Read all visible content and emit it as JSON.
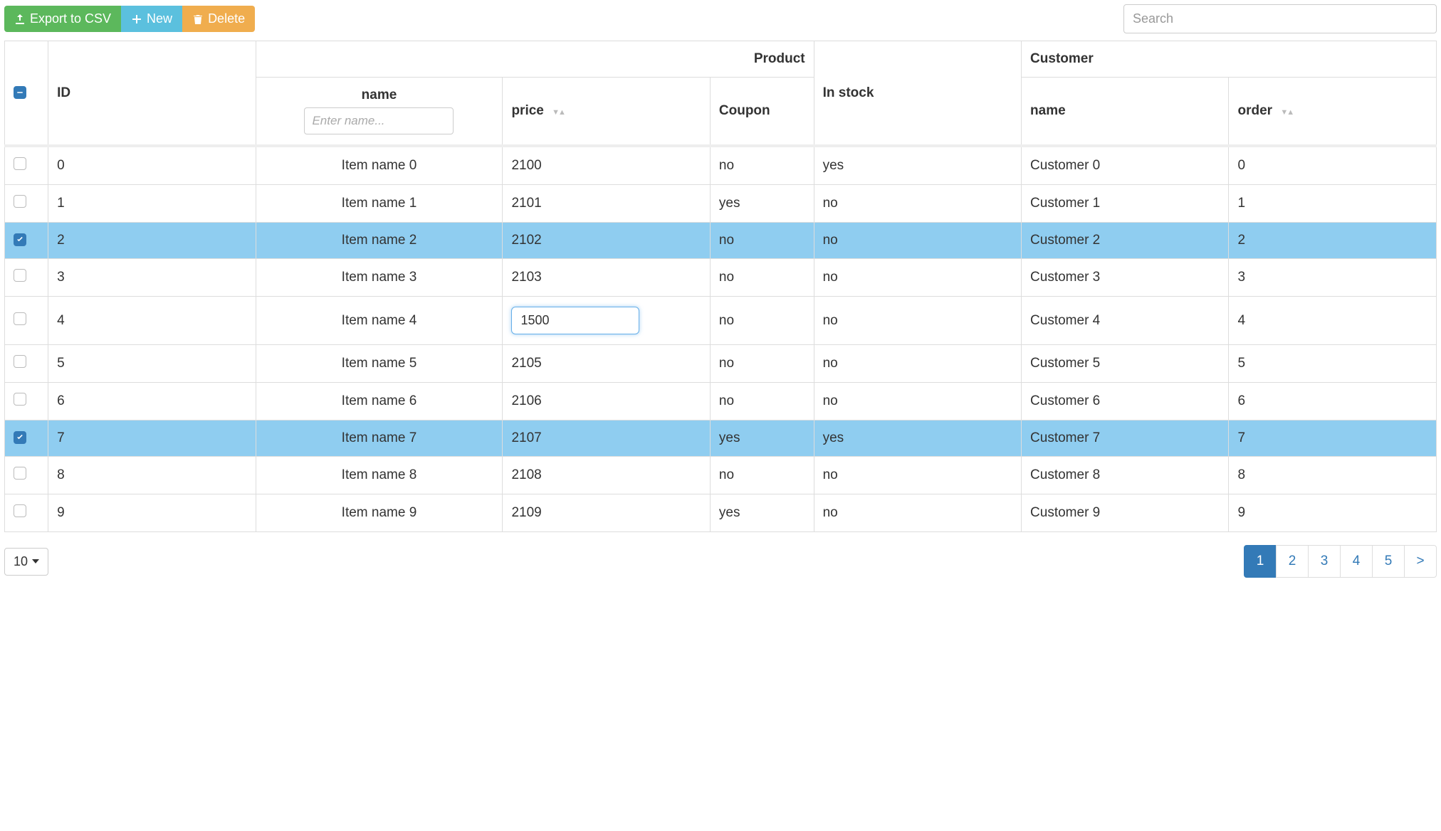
{
  "toolbar": {
    "export_label": "Export to CSV",
    "new_label": "New",
    "delete_label": "Delete",
    "search_placeholder": "Search"
  },
  "headers": {
    "id": "ID",
    "product_group": "Product",
    "name": "name",
    "name_placeholder": "Enter name...",
    "price": "price",
    "coupon": "Coupon",
    "in_stock": "In stock",
    "customer_group": "Customer",
    "customer_name": "name",
    "order": "order"
  },
  "rows": [
    {
      "checked": false,
      "id": "0",
      "name": "Item name 0",
      "price": "2100",
      "coupon": "no",
      "in_stock": "yes",
      "customer": "Customer 0",
      "order": "0",
      "editing": false
    },
    {
      "checked": false,
      "id": "1",
      "name": "Item name 1",
      "price": "2101",
      "coupon": "yes",
      "in_stock": "no",
      "customer": "Customer 1",
      "order": "1",
      "editing": false
    },
    {
      "checked": true,
      "id": "2",
      "name": "Item name 2",
      "price": "2102",
      "coupon": "no",
      "in_stock": "no",
      "customer": "Customer 2",
      "order": "2",
      "editing": false
    },
    {
      "checked": false,
      "id": "3",
      "name": "Item name 3",
      "price": "2103",
      "coupon": "no",
      "in_stock": "no",
      "customer": "Customer 3",
      "order": "3",
      "editing": false
    },
    {
      "checked": false,
      "id": "4",
      "name": "Item name 4",
      "price": "1500",
      "coupon": "no",
      "in_stock": "no",
      "customer": "Customer 4",
      "order": "4",
      "editing": true
    },
    {
      "checked": false,
      "id": "5",
      "name": "Item name 5",
      "price": "2105",
      "coupon": "no",
      "in_stock": "no",
      "customer": "Customer 5",
      "order": "5",
      "editing": false
    },
    {
      "checked": false,
      "id": "6",
      "name": "Item name 6",
      "price": "2106",
      "coupon": "no",
      "in_stock": "no",
      "customer": "Customer 6",
      "order": "6",
      "editing": false
    },
    {
      "checked": true,
      "id": "7",
      "name": "Item name 7",
      "price": "2107",
      "coupon": "yes",
      "in_stock": "yes",
      "customer": "Customer 7",
      "order": "7",
      "editing": false
    },
    {
      "checked": false,
      "id": "8",
      "name": "Item name 8",
      "price": "2108",
      "coupon": "no",
      "in_stock": "no",
      "customer": "Customer 8",
      "order": "8",
      "editing": false
    },
    {
      "checked": false,
      "id": "9",
      "name": "Item name 9",
      "price": "2109",
      "coupon": "yes",
      "in_stock": "no",
      "customer": "Customer 9",
      "order": "9",
      "editing": false
    }
  ],
  "footer": {
    "page_size": "10",
    "pages": [
      "1",
      "2",
      "3",
      "4",
      "5"
    ],
    "next": ">",
    "active_page": "1"
  }
}
